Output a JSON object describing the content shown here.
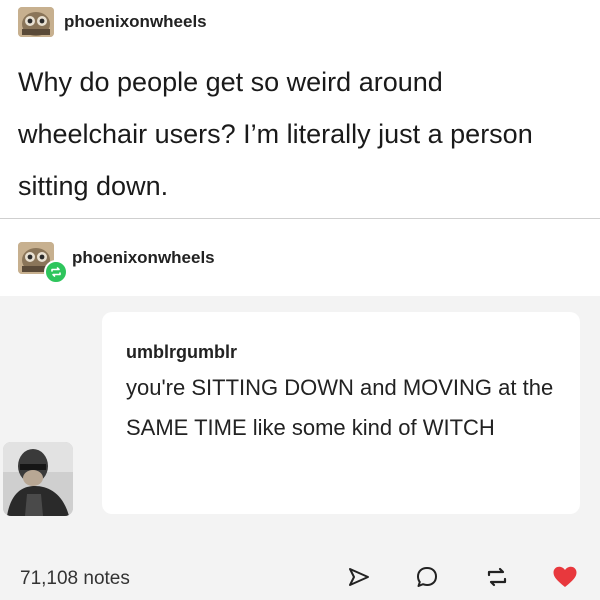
{
  "post": {
    "username": "phoenixonwheels",
    "avatar_icon": "owl-avatar-icon",
    "text": "Why do people get so weird around wheelchair users? I’m literally just a person sitting down."
  },
  "reblog": {
    "username": "phoenixonwheels",
    "badge_icon": "reblog-badge-icon",
    "badge_color": "#2ec55c"
  },
  "ask": {
    "asker": "umblrgumblr",
    "text": "you're SITTING DOWN and MOVING at the SAME TIME like some kind of WITCH"
  },
  "footer": {
    "notes": "71,108 notes",
    "actions": [
      "share-icon",
      "reply-icon",
      "reblog-icon",
      "like-icon"
    ],
    "like_color": "#e8383d"
  }
}
